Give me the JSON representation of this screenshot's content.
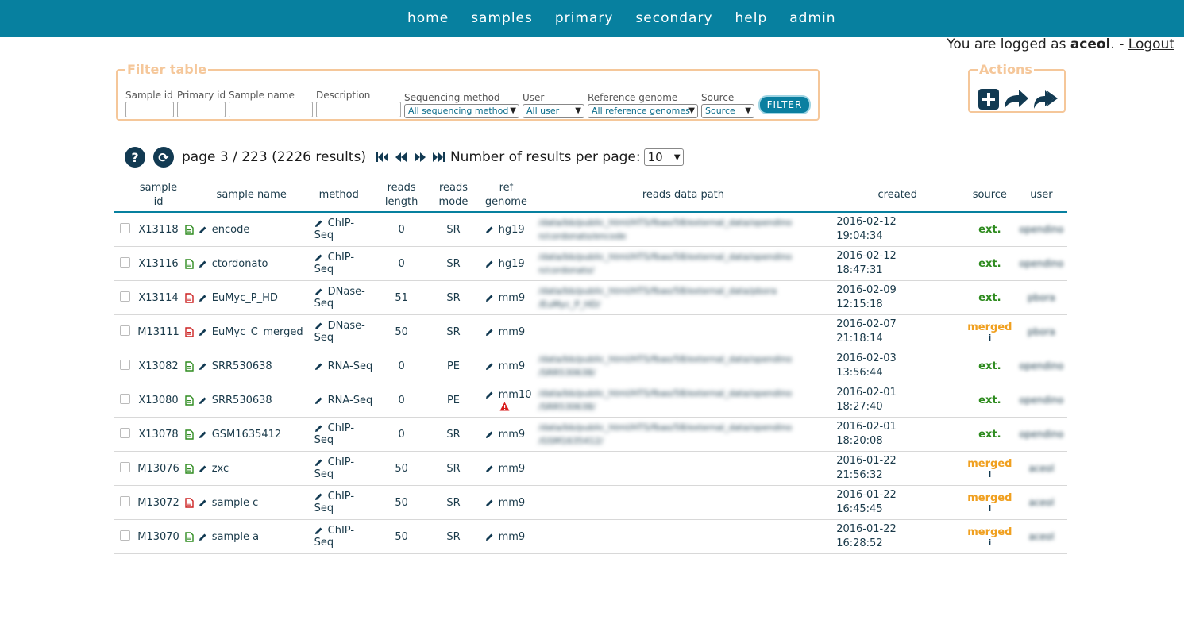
{
  "nav": [
    "home",
    "samples",
    "primary",
    "secondary",
    "help",
    "admin"
  ],
  "login": {
    "prefix": "You are logged as ",
    "user": "aceol",
    "sep": ". - ",
    "logout": "Logout"
  },
  "filter": {
    "legend": "Filter table",
    "labels": {
      "sample_id": "Sample id",
      "primary_id": "Primary id",
      "sample_name": "Sample name",
      "description": "Description",
      "seq_method": "Sequencing method",
      "user": "User",
      "ref_genome": "Reference genome",
      "source": "Source"
    },
    "selects": {
      "seq_method": "All sequencing method",
      "user": "All user",
      "ref_genome": "All reference genomes",
      "source": "Source"
    },
    "button": "FILTER"
  },
  "actions": {
    "legend": "Actions",
    "icons": [
      "plus-square-icon",
      "share-icon",
      "share-all-icon"
    ]
  },
  "pager": {
    "text": "page 3 / 223 (2226 results)",
    "per_page_label": "Number of results per page:",
    "per_page": "10"
  },
  "columns": {
    "sample_id": "sample id",
    "sample_name": "sample name",
    "method": "method",
    "reads_length": "reads length",
    "reads_mode": "reads mode",
    "ref_genome": "ref genome",
    "reads_path": "reads data path",
    "created": "created",
    "source": "source",
    "user": "user"
  },
  "colors": {
    "nav": "#07809f",
    "ext": "#2e8b1f",
    "merged": "#f0a020",
    "accent": "#f5c79a"
  },
  "rows": [
    {
      "id": "X13118",
      "doc": "green",
      "name": "encode",
      "method": "ChIP-Seq",
      "len": "0",
      "mode": "SR",
      "genome": "hg19",
      "warn": false,
      "path1": "/data/bb/public_html/HTS/fbao/58/external_data/opendino",
      "path2": "n/cordonato/encode",
      "date": "2016-02-12",
      "time": "19:04:34",
      "source": "ext.",
      "user": "opendino"
    },
    {
      "id": "X13116",
      "doc": "green",
      "name": "ctordonato",
      "method": "ChIP-Seq",
      "len": "0",
      "mode": "SR",
      "genome": "hg19",
      "warn": false,
      "path1": "/data/bb/public_html/HTS/fbao/58/external_data/opendino",
      "path2": "n/cordonato/",
      "date": "2016-02-12",
      "time": "18:47:31",
      "source": "ext.",
      "user": "opendino"
    },
    {
      "id": "X13114",
      "doc": "red",
      "name": "EuMyc_P_HD",
      "method": "DNase-Seq",
      "len": "51",
      "mode": "SR",
      "genome": "mm9",
      "warn": false,
      "path1": "/data/bb/public_html/HTS/fbao/58/external_data/pbora",
      "path2": "/EuMyc_P_HD/",
      "date": "2016-02-09",
      "time": "12:15:18",
      "source": "ext.",
      "user": "pbora"
    },
    {
      "id": "M13111",
      "doc": "red",
      "name": "EuMyc_C_merged",
      "method": "DNase-Seq",
      "len": "50",
      "mode": "SR",
      "genome": "mm9",
      "warn": false,
      "path1": "",
      "path2": "",
      "date": "2016-02-07",
      "time": "21:18:14",
      "source": "merged",
      "user": "pbora"
    },
    {
      "id": "X13082",
      "doc": "green",
      "name": "SRR530638",
      "method": "RNA-Seq",
      "len": "0",
      "mode": "PE",
      "genome": "mm9",
      "warn": false,
      "path1": "/data/bb/public_html/HTS/fbao/58/external_data/opendino",
      "path2": "/SRR530638/",
      "date": "2016-02-03",
      "time": "13:56:44",
      "source": "ext.",
      "user": "opendino"
    },
    {
      "id": "X13080",
      "doc": "green",
      "name": "SRR530638",
      "method": "RNA-Seq",
      "len": "0",
      "mode": "PE",
      "genome": "mm10",
      "warn": true,
      "path1": "/data/bb/public_html/HTS/fbao/58/external_data/opendino",
      "path2": "/SRR530638/",
      "date": "2016-02-01",
      "time": "18:27:40",
      "source": "ext.",
      "user": "opendino"
    },
    {
      "id": "X13078",
      "doc": "green",
      "name": "GSM1635412",
      "method": "ChIP-Seq",
      "len": "0",
      "mode": "SR",
      "genome": "mm9",
      "warn": false,
      "path1": "/data/bb/public_html/HTS/fbao/58/external_data/opendino",
      "path2": "/GSM1635412/",
      "date": "2016-02-01",
      "time": "18:20:08",
      "source": "ext.",
      "user": "opendino"
    },
    {
      "id": "M13076",
      "doc": "green",
      "name": "zxc",
      "method": "ChIP-Seq",
      "len": "50",
      "mode": "SR",
      "genome": "mm9",
      "warn": false,
      "path1": "",
      "path2": "",
      "date": "2016-01-22",
      "time": "21:56:32",
      "source": "merged",
      "user": "aceol"
    },
    {
      "id": "M13072",
      "doc": "red",
      "name": "sample c",
      "method": "ChIP-Seq",
      "len": "50",
      "mode": "SR",
      "genome": "mm9",
      "warn": false,
      "path1": "",
      "path2": "",
      "date": "2016-01-22",
      "time": "16:45:45",
      "source": "merged",
      "user": "aceol"
    },
    {
      "id": "M13070",
      "doc": "green",
      "name": "sample a",
      "method": "ChIP-Seq",
      "len": "50",
      "mode": "SR",
      "genome": "mm9",
      "warn": false,
      "path1": "",
      "path2": "",
      "date": "2016-01-22",
      "time": "16:28:52",
      "source": "merged",
      "user": "aceol"
    }
  ]
}
